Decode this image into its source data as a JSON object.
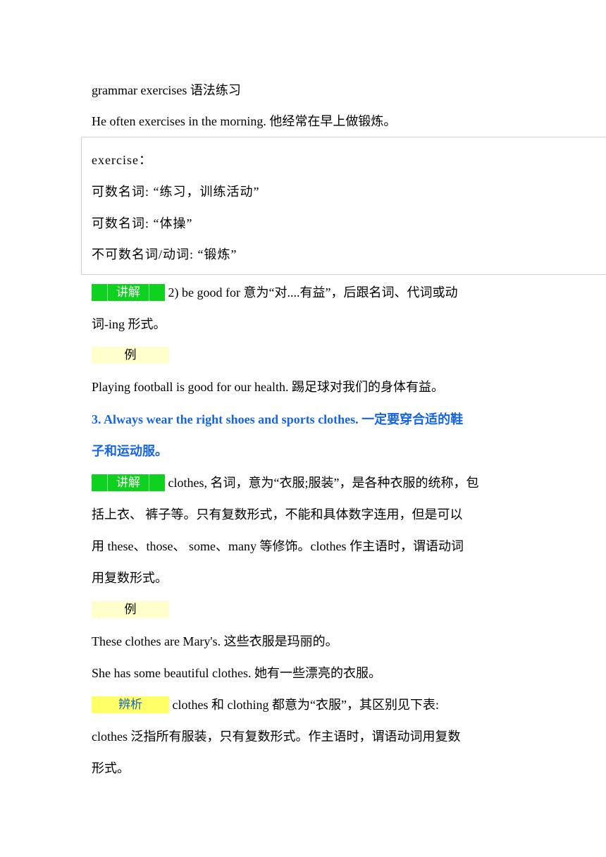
{
  "lines": {
    "l1": "grammar exercises  语法练习",
    "l2": "He often exercises in the morning.  他经常在早上做锻炼。"
  },
  "box": {
    "title": "exercise：",
    "item1": "可数名词: “练习，训练活动”",
    "item2": "可数名词: “体操”",
    "item3": "不可数名词/动词: “锻炼”"
  },
  "tags": {
    "explain": "讲解",
    "example": "例",
    "distinguish": "辨析"
  },
  "section2": {
    "explain_a": " 2) be good for 意为“对....有益”，后跟名词、代词或动",
    "explain_b": "词-ing 形式。",
    "example_1": "Playing football is good for our health.  踢足球对我们的身体有益。"
  },
  "section3": {
    "heading_a": "3. Always wear the right shoes and sports clothes.  一定要穿合适的鞋",
    "heading_b": "子和运动服。",
    "explain_a": " clothes,  名词，意为“衣服;服装”，是各种衣服的统称，包",
    "explain_b": "括上衣、  裤子等。只有复数形式，不能和具体数字连用，但是可以",
    "explain_c": "用 these、those、  some、many  等修饰。clothes 作主语时，谓语动词",
    "explain_d": "用复数形式。",
    "example_1": "These clothes are Mary's.  这些衣服是玛丽的。",
    "example_2": "She has some beautiful clothes.  她有一些漂亮的衣服。",
    "distinguish_a": "  clothes 和 clothing 都意为“衣服”，其区别见下表:",
    "distinguish_b": "clothes  泛指所有服装，只有复数形式。作主语时，谓语动词用复数",
    "distinguish_c": "形式。"
  },
  "colors": {
    "tag_green": "#0fd11f",
    "tag_yellow_light": "#ffffcc",
    "tag_yellow": "#ffff66",
    "heading_blue": "#1565e6"
  }
}
